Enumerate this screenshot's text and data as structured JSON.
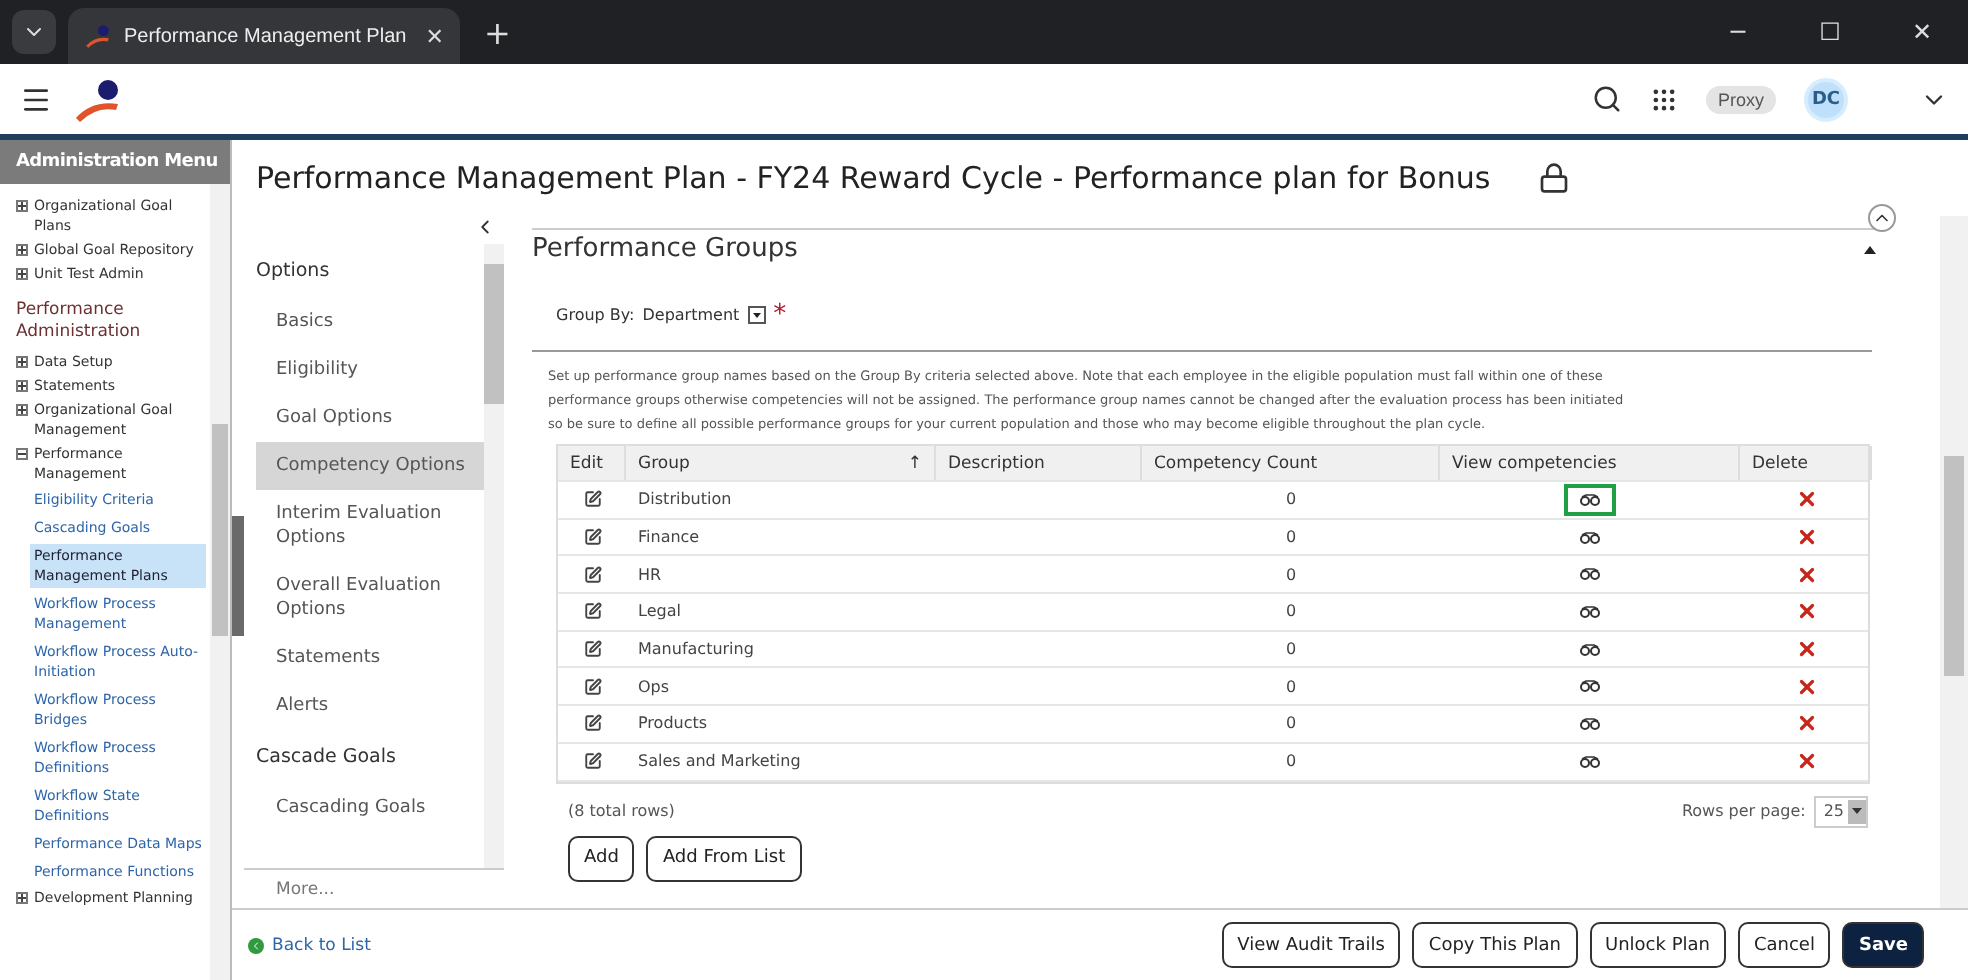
{
  "browser": {
    "tab_title": "Performance Management Plan",
    "tab_close": "✕",
    "new_tab": "+",
    "window_controls": [
      "─",
      "☐",
      "✕"
    ]
  },
  "header": {
    "proxy": "Proxy",
    "avatar": "DC"
  },
  "sidebar": {
    "title": "Administration Menu",
    "groups": [
      {
        "items": [
          {
            "label": "Organizational Goal Plans",
            "expanded": false
          },
          {
            "label": "Global Goal Repository",
            "expanded": false
          },
          {
            "label": "Unit Test Admin",
            "expanded": false
          }
        ]
      },
      {
        "heading": "Performance Administration",
        "items": [
          {
            "label": "Data Setup",
            "expanded": false
          },
          {
            "label": "Statements",
            "expanded": false
          },
          {
            "label": "Organizational Goal Management",
            "expanded": false
          },
          {
            "label": "Performance Management",
            "expanded": true,
            "children": [
              {
                "label": "Eligibility Criteria",
                "selected": false
              },
              {
                "label": "Cascading Goals",
                "selected": false
              },
              {
                "label": "Performance Management Plans",
                "selected": true
              },
              {
                "label": "Workflow Process Management",
                "selected": false
              },
              {
                "label": "Workflow Process Auto-Initiation",
                "selected": false
              },
              {
                "label": "Workflow Process Bridges",
                "selected": false
              },
              {
                "label": "Workflow Process Definitions",
                "selected": false
              },
              {
                "label": "Workflow State Definitions",
                "selected": false
              },
              {
                "label": "Performance Data Maps",
                "selected": false
              },
              {
                "label": "Performance Functions",
                "selected": false
              }
            ]
          },
          {
            "label": "Development Planning",
            "expanded": false
          }
        ]
      }
    ]
  },
  "page_title": "Performance Management Plan - FY24 Reward Cycle - Performance plan for Bonus",
  "options_nav": {
    "sections": [
      {
        "heading": "Options",
        "items": [
          {
            "label": "Basics",
            "selected": false
          },
          {
            "label": "Eligibility",
            "selected": false
          },
          {
            "label": "Goal Options",
            "selected": false
          },
          {
            "label": "Competency Options",
            "selected": true
          },
          {
            "label": "Interim Evaluation Options",
            "selected": false
          },
          {
            "label": "Overall Evaluation Options",
            "selected": false
          },
          {
            "label": "Statements",
            "selected": false
          },
          {
            "label": "Alerts",
            "selected": false
          }
        ]
      },
      {
        "heading": "Cascade Goals",
        "items": [
          {
            "label": "Cascading Goals",
            "selected": false
          }
        ]
      }
    ],
    "more": "More..."
  },
  "section": {
    "title": "Performance Groups",
    "group_by_label": "Group By:",
    "group_by_value": "Department",
    "required_mark": "*",
    "note": "Set up performance group names based on the Group By criteria selected above. Note that each employee in the eligible population must fall within one of these performance groups otherwise competencies will not be assigned. The performance group names cannot be changed after the evaluation process has been initiated so be sure to define all possible performance groups for your current population and those who may become eligible throughout the plan cycle.",
    "table": {
      "columns": [
        "Edit",
        "Group",
        "Description",
        "Competency Count",
        "View competencies",
        "Delete"
      ],
      "sort_mark": "↑",
      "rows": [
        {
          "group": "Distribution",
          "competency_count": "0",
          "focused": true
        },
        {
          "group": "Finance",
          "competency_count": "0",
          "focused": false
        },
        {
          "group": "HR",
          "competency_count": "0",
          "focused": false
        },
        {
          "group": "Legal",
          "competency_count": "0",
          "focused": false
        },
        {
          "group": "Manufacturing",
          "competency_count": "0",
          "focused": false
        },
        {
          "group": "Ops",
          "competency_count": "0",
          "focused": false
        },
        {
          "group": "Products",
          "competency_count": "0",
          "focused": false
        },
        {
          "group": "Sales and Marketing",
          "competency_count": "0",
          "focused": false
        }
      ]
    },
    "total_rows": "(8 total rows)",
    "rows_per_page_label": "Rows per page:",
    "rows_per_page": "25",
    "buttons": [
      "Add",
      "Add From List"
    ]
  },
  "footer": {
    "back_link": "Back to List",
    "buttons": [
      {
        "label": "View Audit Trails",
        "kind": "secondary"
      },
      {
        "label": "Copy This Plan",
        "kind": "secondary"
      },
      {
        "label": "Unlock Plan",
        "kind": "secondary"
      },
      {
        "label": "Cancel",
        "kind": "secondary"
      },
      {
        "label": "Save",
        "kind": "primary"
      }
    ]
  }
}
